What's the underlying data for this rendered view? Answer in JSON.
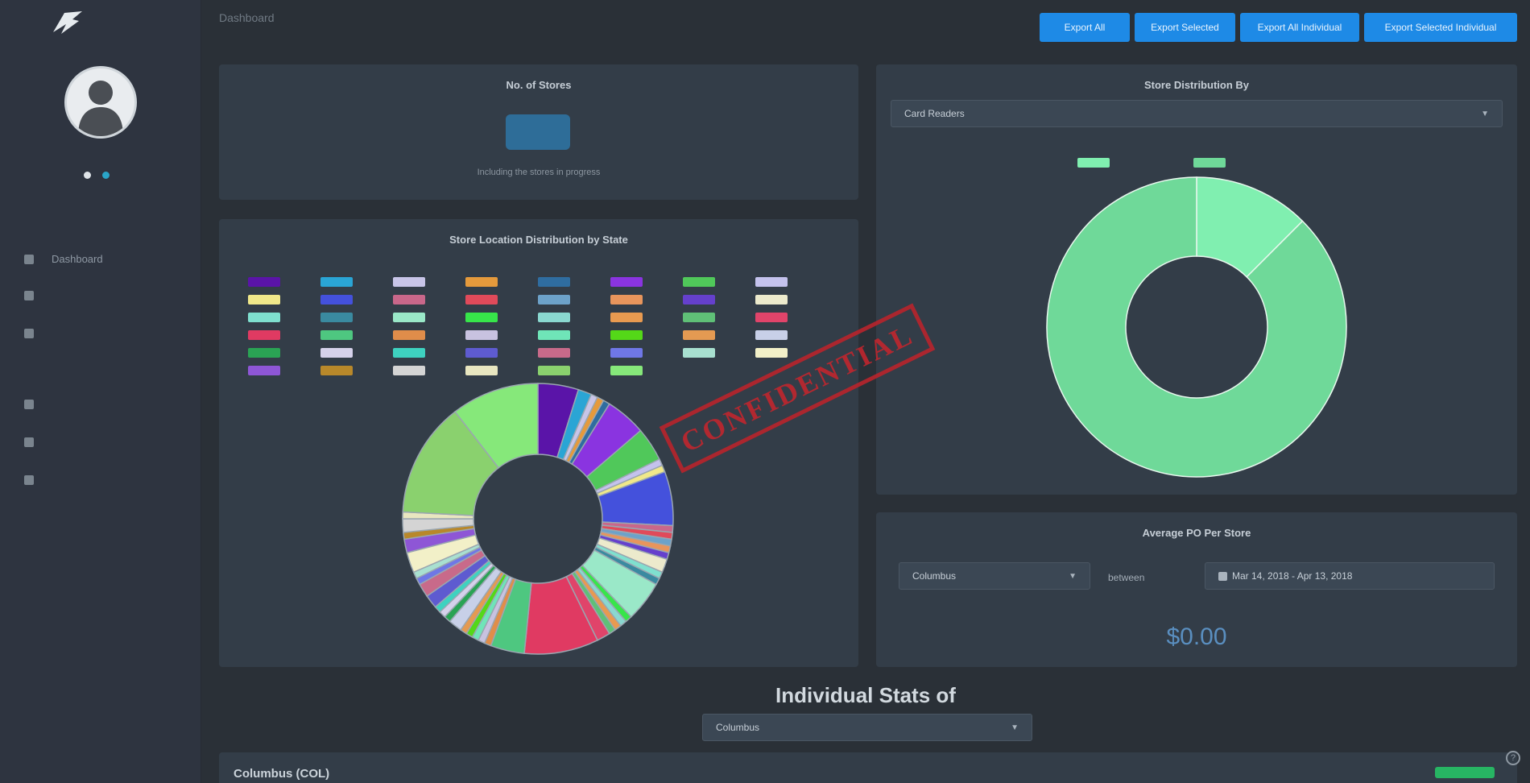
{
  "brand": {
    "line1": "",
    "line2": ""
  },
  "user": {
    "name": ""
  },
  "sidebar": {
    "sections": [
      {
        "label": ""
      },
      {
        "label": ""
      }
    ],
    "items": [
      {
        "label": "Dashboard",
        "icon": "dashboard-icon"
      },
      {
        "label": "",
        "icon": "list-icon"
      },
      {
        "label": "",
        "icon": "store-icon"
      },
      {
        "label": "",
        "icon": "receipt-icon"
      },
      {
        "label": "",
        "icon": "grid-icon"
      },
      {
        "label": "",
        "icon": "shop-icon"
      }
    ]
  },
  "header": {
    "title": "Dashboard",
    "buttons": [
      "Export All",
      "Export Selected",
      "Export All Individual",
      "Export Selected Individual"
    ]
  },
  "stores_card": {
    "title": "No. of Stores",
    "subtitle": "Including the stores in progress"
  },
  "location_card": {
    "title": "Store Location Distribution by State"
  },
  "distribution_card": {
    "title": "Store Distribution By",
    "selected": "Card Readers"
  },
  "avg_card": {
    "title": "Average PO Per Store",
    "store_selected": "Columbus",
    "between_label": "between",
    "date_range": "Mar 14, 2018 - Apr 13, 2018",
    "value": "$0.00"
  },
  "individual": {
    "title": "Individual Stats of",
    "selected": "Columbus",
    "card_title": "Columbus (COL)",
    "badge": ""
  },
  "stamp": "CONFIDENTIAL",
  "colors": {
    "accent": "#1e8ae6",
    "card": "#333d48",
    "background": "#2a3037",
    "badge": "#27b563"
  },
  "chart_data": [
    {
      "type": "pie",
      "title": "Store Distribution By",
      "legend_position": "top",
      "categories": [
        "",
        ""
      ],
      "values": [
        1,
        7
      ],
      "colors": [
        "#80efb0",
        "#6fd999"
      ]
    },
    {
      "type": "pie",
      "title": "Store Location Distribution by State",
      "legend_position": "top",
      "values": [
        6,
        2,
        1,
        1,
        1,
        6,
        5,
        1,
        1,
        8,
        1,
        1,
        1,
        1,
        1,
        2,
        1,
        1,
        6,
        1,
        1,
        1,
        1,
        2,
        11,
        5,
        1,
        1,
        1,
        1,
        1,
        2,
        1,
        1,
        1,
        2,
        2,
        1,
        1,
        3,
        2,
        1,
        2,
        1,
        17,
        13
      ],
      "colors": [
        "#5a14a8",
        "#2aa5d5",
        "#c8c5e8",
        "#e59a3c",
        "#2f6da0",
        "#8a34e0",
        "#50c85a",
        "#c4c2ed",
        "#f0e88a",
        "#4451dc",
        "#c9678a",
        "#e04a5a",
        "#6da2c9",
        "#e8955c",
        "#6540cc",
        "#eceacc",
        "#7fe0cf",
        "#3a8aa0",
        "#9ae8c8",
        "#37e54a",
        "#8ad8d0",
        "#e89a50",
        "#5fc077",
        "#e0446a",
        "#e03a62",
        "#4ec780",
        "#e08d4a",
        "#c8c2e0",
        "#6fe5b8",
        "#54d818",
        "#e49a52",
        "#c8d0e8",
        "#2aa354",
        "#d5d1ea",
        "#3ed2c0",
        "#5e5bd0",
        "#c86a8a",
        "#6f77e6",
        "#a8e0d0",
        "#f2f0c8",
        "#8e56d6",
        "#b8882a",
        "#d4d4d4",
        "#e8e6c0",
        "#8ad16e",
        "#86e87a"
      ]
    }
  ]
}
